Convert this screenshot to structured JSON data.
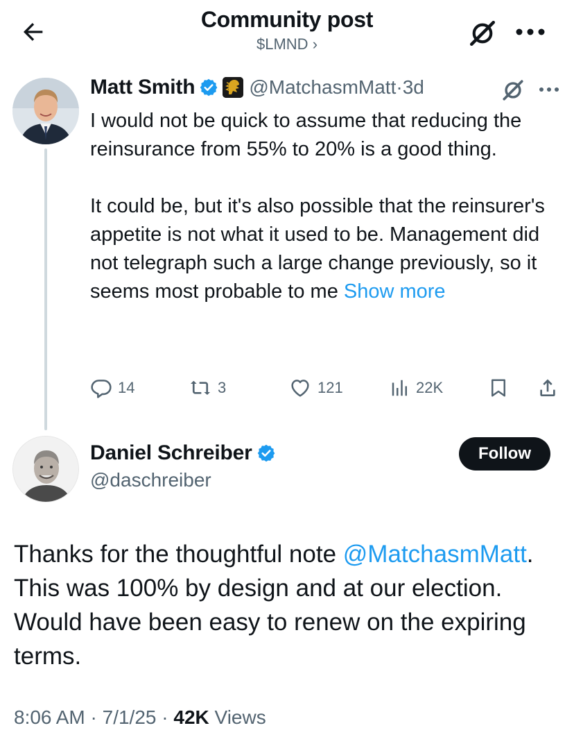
{
  "header": {
    "title": "Community post",
    "community": "$LMND",
    "chevron": "›"
  },
  "parent_tweet": {
    "author_name": "Matt Smith",
    "handle": "@MatchasmMatt",
    "separator": "·",
    "time": "3d",
    "paragraph1": "I would not be quick to assume that reducing the reinsurance from 55% to 20% is a good thing.",
    "paragraph2": "It could be, but it's also possible that the reinsurer's appetite is not what it used to be. Management did not telegraph such a large change previously, so it seems most probable to me",
    "show_more": "Show more",
    "stats": {
      "replies": "14",
      "reposts": "3",
      "likes": "121",
      "views": "22K"
    }
  },
  "reply_tweet": {
    "author_name": "Daniel Schreiber",
    "handle": "@daschreiber",
    "follow_label": "Follow",
    "text_before_mention": "Thanks for the thoughtful note ",
    "mention": "@MatchasmMatt",
    "text_after_mention": ". This was 100% by design and at our election. Would have been easy to renew on the expiring terms.",
    "time": "8:06 AM",
    "date": "7/1/25",
    "view_count": "42K",
    "views_label": "Views"
  },
  "icons": {
    "back": "arrow-left-icon",
    "grok": "grok-icon",
    "more": "more-dots-icon",
    "verified": "verified-badge-icon",
    "org": "lion-org-badge-icon",
    "reply": "reply-bubble-icon",
    "repost": "repost-icon",
    "like": "heart-icon",
    "views": "views-bar-chart-icon",
    "bookmark": "bookmark-icon",
    "share": "share-icon"
  },
  "colors": {
    "text": "#0f1419",
    "secondary": "#536471",
    "link": "#1d9bf0",
    "verified": "#1d9bf0",
    "thread_line": "#cfd9de",
    "follow_bg": "#0f1419"
  }
}
